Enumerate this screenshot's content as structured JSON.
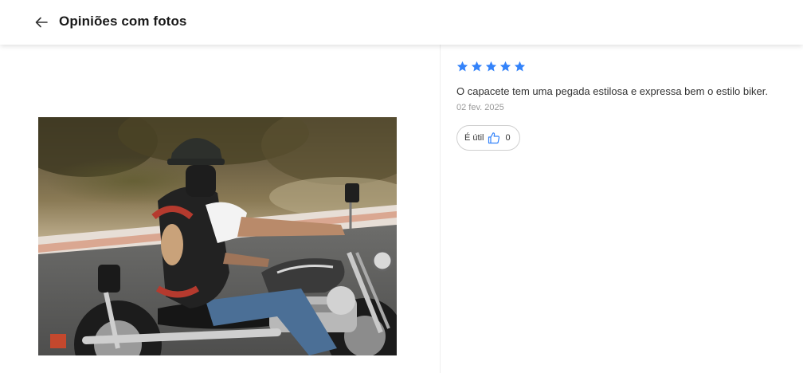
{
  "header": {
    "title": "Opiniões com fotos",
    "back_icon": "arrow-left-icon"
  },
  "review": {
    "rating": 5,
    "rating_max": 5,
    "star_color": "#3483fa",
    "text": "O capacete tem uma pegada estilosa e expressa bem o estilo biker.",
    "date": "02 fev. 2025",
    "useful_label": "É útil",
    "useful_icon": "thumbs-up-icon",
    "useful_count": "0",
    "accent_color": "#3483fa"
  }
}
